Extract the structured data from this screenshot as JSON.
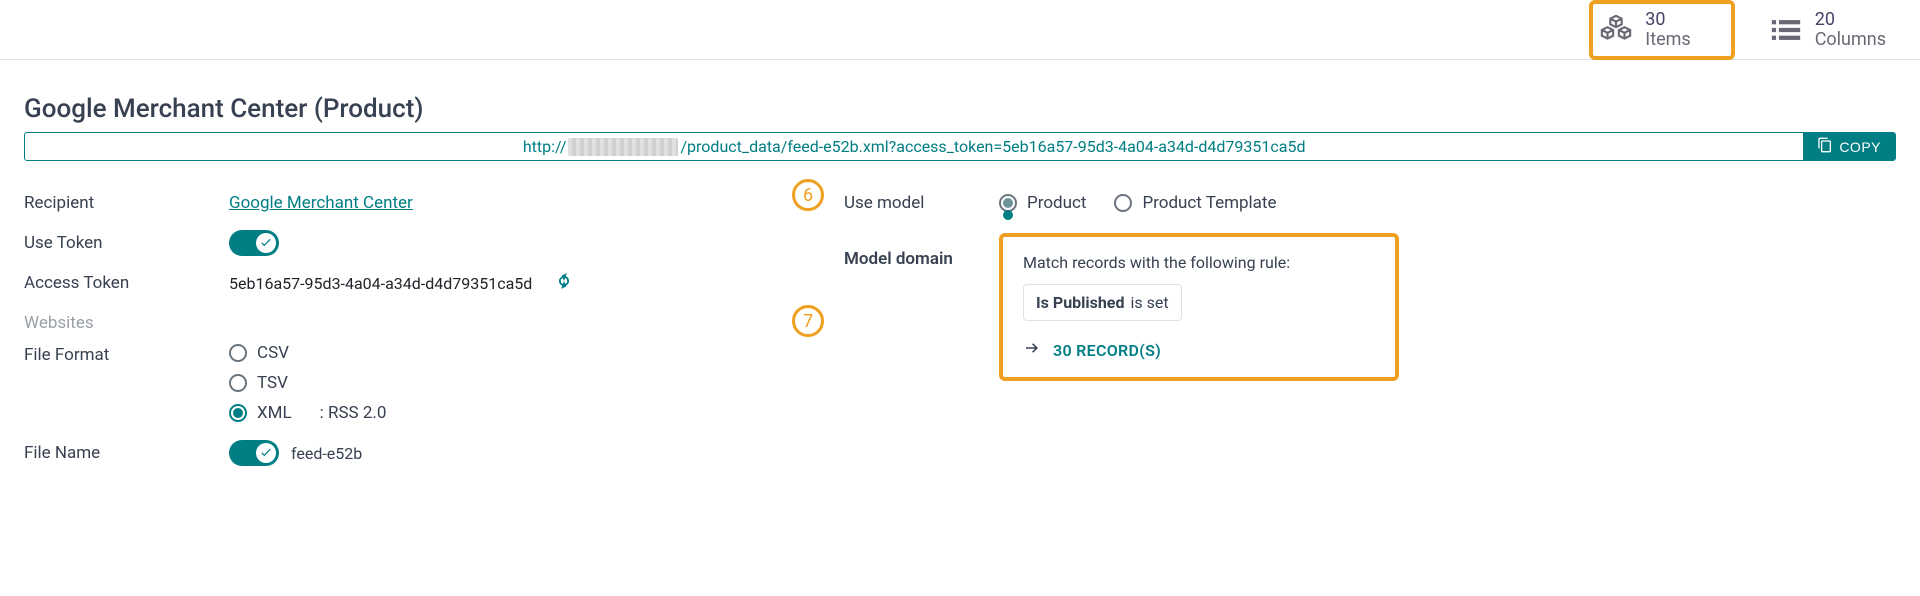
{
  "header": {
    "items": {
      "count": "30",
      "label": "Items"
    },
    "columns": {
      "count": "20",
      "label": "Columns"
    }
  },
  "page": {
    "title": "Google Merchant Center (Product)"
  },
  "url": {
    "proto": "http://",
    "path": "/product_data/feed-e52b.xml?access_token=5eb16a57-95d3-4a04-a34d-d4d79351ca5d",
    "copy_label": "COPY"
  },
  "left": {
    "recipient_label": "Recipient",
    "recipient_value": "Google Merchant Center",
    "use_token_label": "Use Token",
    "access_token_label": "Access Token",
    "access_token_value": "5eb16a57-95d3-4a04-a34d-d4d79351ca5d",
    "websites_label": "Websites",
    "file_format_label": "File Format",
    "formats": {
      "csv": "CSV",
      "tsv": "TSV",
      "xml": "XML"
    },
    "xml_suffix": ":   RSS 2.0",
    "file_name_label": "File Name",
    "file_name_value": "feed-e52b"
  },
  "right": {
    "use_model_label": "Use model",
    "model_options": {
      "product": "Product",
      "product_template": "Product Template"
    },
    "model_domain_label": "Model domain",
    "domain_intro": "Match records with the following rule:",
    "rule_field": "Is Published",
    "rule_op": "is set",
    "records_text": "30 RECORD(S)"
  },
  "callouts": {
    "c6": "6",
    "c7": "7"
  }
}
